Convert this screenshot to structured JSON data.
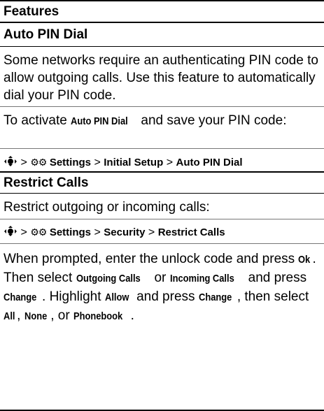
{
  "header": {
    "title": "Features"
  },
  "sections": [
    {
      "title": "Auto PIN Dial",
      "intro": "Some networks require an authenticating PIN code to allow outgoing calls. Use this feature to automatically dial your PIN code.",
      "activate_pre": "To activate",
      "activate_term": "Auto PIN Dial",
      "activate_post": "and save your PIN code:",
      "path": [
        "Settings",
        "Initial Setup",
        "Auto PIN Dial"
      ]
    },
    {
      "title": "Restrict Calls",
      "intro": "Restrict outgoing or incoming calls:",
      "path": [
        "Settings",
        "Security",
        "Restrict Calls"
      ],
      "steps": {
        "t1": "When prompted, enter the unlock code and press",
        "k1": "Ok",
        "t2": ". Then select",
        "k2": "Outgoing Calls",
        "t3": "or",
        "k3": "Incoming Calls",
        "t4": "and press",
        "k4": "Change",
        "t5": ". Highlight",
        "k5": "Allow",
        "t6": "and press",
        "k6": "Change",
        "t7": ", then select",
        "k7": "All",
        "t8": ",",
        "k8": "None",
        "t9": ", or",
        "k9": "Phonebook",
        "t10": "."
      }
    }
  ],
  "icons": {
    "nav_key": "nav-key-icon",
    "settings": "settings-icon"
  },
  "path_sep": ">"
}
